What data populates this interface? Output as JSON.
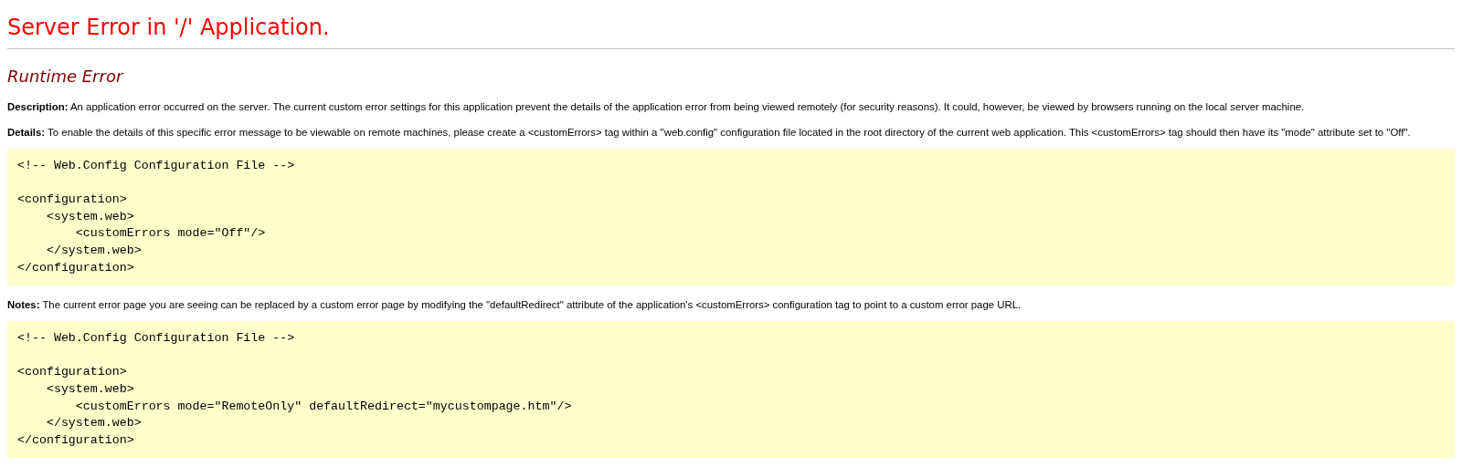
{
  "title": "Server Error in '/' Application.",
  "subtitle": "Runtime Error",
  "sections": [
    {
      "kind": "text",
      "text": "**Description:** An application error occurred on the server. The current custom error settings for this application prevent the details of the application error from being viewed remotely (for security reasons). It could, however, be viewed by browsers running on the local server machine."
    },
    {
      "kind": "text",
      "text": "**Details:** To enable the details of this specific error message to be viewable on remote machines, please create a <customErrors> tag within a \"web.config\" configuration file located in the root directory of the current web application. This <customErrors> tag should then have its \"mode\" attribute set to \"Off\"."
    },
    {
      "kind": "code",
      "comment": "<!-- Web.Config Configuration File -->",
      "lines": [
        "<configuration>",
        "    <system.web>",
        "        <customErrors mode=\"Off\"/>",
        "    </system.web>",
        "</configuration>"
      ]
    },
    {
      "kind": "text",
      "text": "**Notes:** The current error page you are seeing can be replaced by a custom error page by modifying the \"defaultRedirect\" attribute of the application's <customErrors> configuration tag to point to a custom error page URL."
    },
    {
      "kind": "code",
      "comment": "<!-- Web.Config Configuration File -->",
      "lines": [
        "<configuration>",
        "    <system.web>",
        "        <customErrors mode=\"RemoteOnly\" defaultRedirect=\"mycustompage.htm\"/>",
        "    </system.web>",
        "</configuration>"
      ]
    }
  ]
}
